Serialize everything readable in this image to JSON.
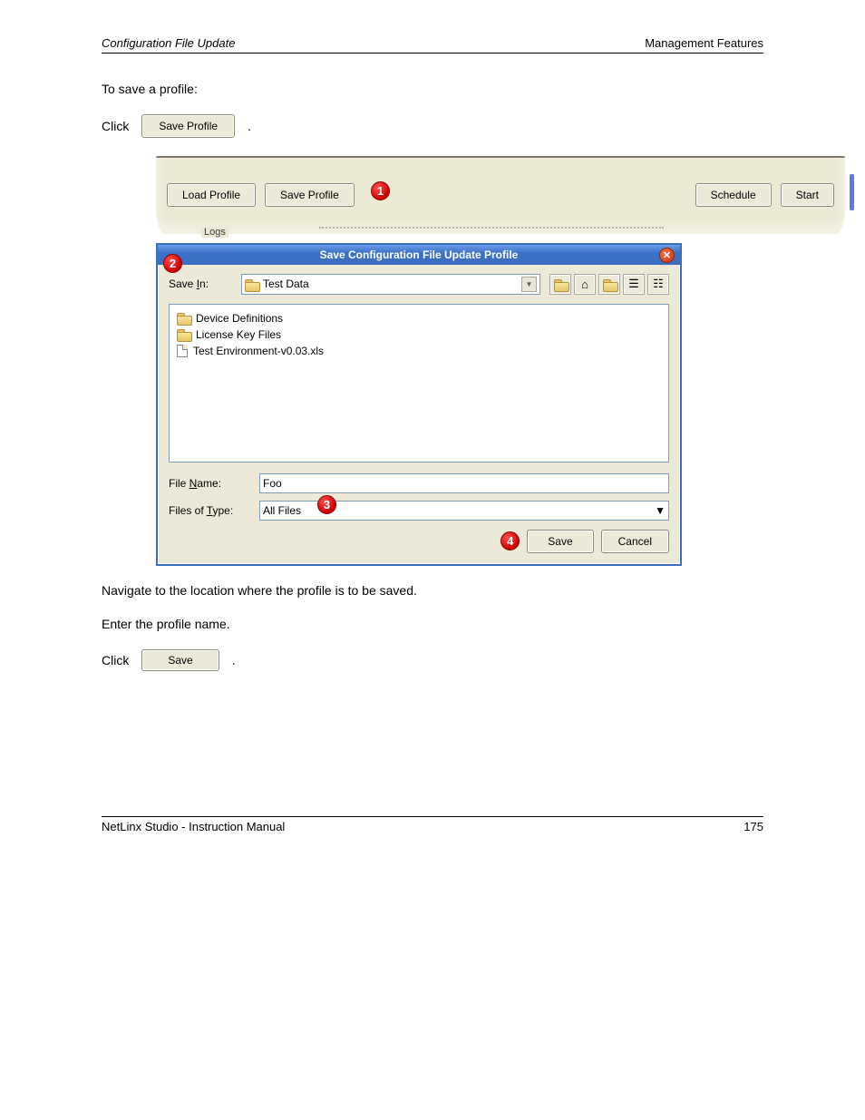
{
  "header": {
    "left": "Configuration File Update",
    "right": "Management Features"
  },
  "intro": "To save a profile:",
  "step1": {
    "text_before": "Click",
    "button_label": "Save Profile",
    "text_after": "."
  },
  "shot1": {
    "buttons": {
      "load_profile": "Load Profile",
      "save_profile": "Save Profile",
      "schedule": "Schedule",
      "start": "Start"
    },
    "logs_fragment": "Logs"
  },
  "dialog": {
    "title": "Save Configuration File Update Profile",
    "save_in_label": "Save In:",
    "save_in_value": "Test Data",
    "files": [
      {
        "type": "folder",
        "name": "Device Definitions"
      },
      {
        "type": "folder",
        "name": "License Key Files"
      },
      {
        "type": "file",
        "name": "Test Environment-v0.03.xls"
      }
    ],
    "file_name_label": "File Name:",
    "file_name_value": "Foo",
    "file_type_label": "Files of Type:",
    "file_type_value": "All Files",
    "save_btn": "Save",
    "cancel_btn": "Cancel"
  },
  "step2": "Navigate to the location where the profile is to be saved.",
  "step3": "Enter the profile name.",
  "step4": {
    "text_before": "Click",
    "button_label": "Save",
    "text_after": "."
  },
  "footer": {
    "left": "NetLinx Studio - Instruction Manual",
    "right": "175"
  }
}
